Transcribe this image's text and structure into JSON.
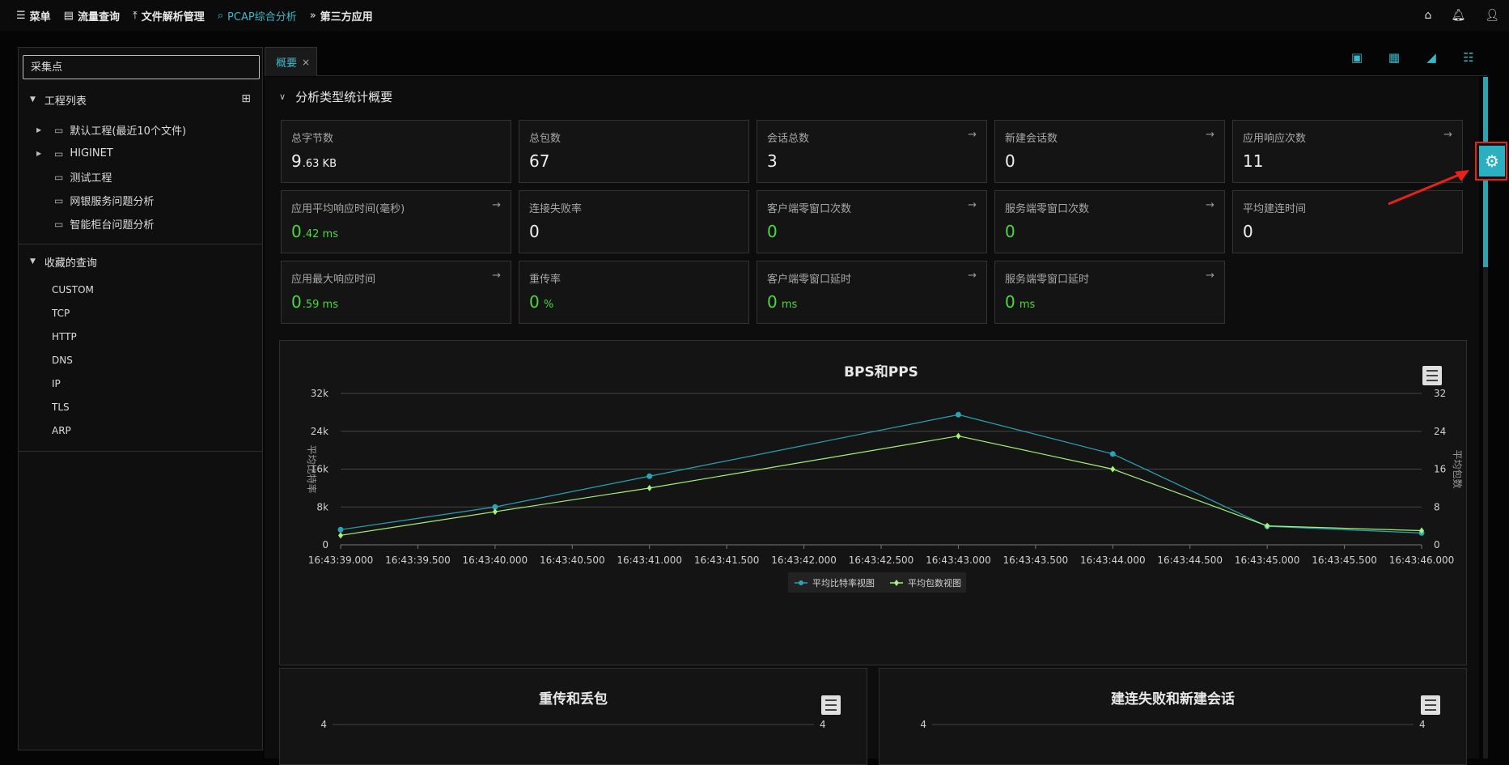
{
  "topnav": {
    "items": [
      {
        "label": "菜单",
        "icon": "hamburger-icon",
        "glyph": "☰"
      },
      {
        "label": "流量查询",
        "icon": "document-icon",
        "glyph": "▤"
      },
      {
        "label": "文件解析管理",
        "icon": "upload-icon",
        "glyph": "⤒"
      },
      {
        "label": "PCAP综合分析",
        "icon": "search-icon",
        "glyph": "⌕"
      },
      {
        "label": "第三方应用",
        "icon": "double-chevron-icon",
        "glyph": "»"
      }
    ]
  },
  "sidebar": {
    "search_placeholder": "采集点",
    "project_title": "工程列表",
    "projects": [
      "默认工程(最近10个文件)",
      "HIGINET",
      "测试工程",
      "网银服务问题分析",
      "智能柜台问题分析"
    ],
    "favorites_title": "收藏的查询",
    "queries": [
      "CUSTOM",
      "TCP",
      "HTTP",
      "DNS",
      "IP",
      "TLS",
      "ARP"
    ]
  },
  "tab": {
    "label": "概要"
  },
  "section": {
    "title": "分析类型统计概要"
  },
  "cards": [
    {
      "label": "总字节数",
      "value": "9",
      "unit": ".63 KB",
      "arrow": false,
      "green": false
    },
    {
      "label": "总包数",
      "value": "67",
      "unit": "",
      "arrow": false,
      "green": false
    },
    {
      "label": "会话总数",
      "value": "3",
      "unit": "",
      "arrow": true,
      "green": false
    },
    {
      "label": "新建会话数",
      "value": "0",
      "unit": "",
      "arrow": true,
      "green": false
    },
    {
      "label": "应用响应次数",
      "value": "11",
      "unit": "",
      "arrow": true,
      "green": false
    },
    {
      "label": "应用平均响应时间(毫秒)",
      "value": "0",
      "unit": ".42 ms",
      "arrow": true,
      "green": true
    },
    {
      "label": "连接失败率",
      "value": "0",
      "unit": "",
      "arrow": false,
      "green": false
    },
    {
      "label": "客户端零窗口次数",
      "value": "0",
      "unit": "",
      "arrow": true,
      "green": true
    },
    {
      "label": "服务端零窗口次数",
      "value": "0",
      "unit": "",
      "arrow": true,
      "green": true
    },
    {
      "label": "平均建连时间",
      "value": "0",
      "unit": "",
      "arrow": false,
      "green": false
    },
    {
      "label": "应用最大响应时间",
      "value": "0",
      "unit": ".59 ms",
      "arrow": true,
      "green": true
    },
    {
      "label": "重传率",
      "value": "0",
      "unit": " %",
      "arrow": false,
      "green": true
    },
    {
      "label": "客户端零窗口延时",
      "value": "0",
      "unit": " ms",
      "arrow": true,
      "green": true
    },
    {
      "label": "服务端零窗口延时",
      "value": "0",
      "unit": " ms",
      "arrow": true,
      "green": true
    }
  ],
  "colors": {
    "accent": "#3ab8c8",
    "green": "#4ad93a",
    "bps": "#2aa3b3",
    "pps": "#a6f27a",
    "highlight": "#e8211a"
  },
  "chart_data": [
    {
      "type": "line",
      "title": "BPS和PPS",
      "ylabel_left": "平均比特率",
      "ylabel_right": "平均包数",
      "x": [
        "16:43:39.000",
        "16:43:39.500",
        "16:43:40.000",
        "16:43:40.500",
        "16:43:41.000",
        "16:43:41.500",
        "16:43:42.000",
        "16:43:42.500",
        "16:43:43.000",
        "16:43:43.500",
        "16:43:44.000",
        "16:43:44.500",
        "16:43:45.000",
        "16:43:45.500",
        "16:43:46.000"
      ],
      "y_left_ticks": [
        "0",
        "8k",
        "16k",
        "24k",
        "32k"
      ],
      "y_right_ticks": [
        "0",
        "8",
        "16",
        "24",
        "32"
      ],
      "ylim": [
        0,
        32000
      ],
      "grid": true,
      "legend": "bottom",
      "series": [
        {
          "name": "平均比特率视图",
          "axis": "left",
          "x": [
            0,
            2,
            4,
            8,
            10,
            12,
            14
          ],
          "values": [
            3200,
            8000,
            14500,
            27500,
            19200,
            3900,
            2500
          ]
        },
        {
          "name": "平均包数视图",
          "axis": "right",
          "x": [
            0,
            2,
            4,
            8,
            10,
            12,
            14
          ],
          "values": [
            2,
            7,
            12,
            23,
            16,
            4,
            3
          ]
        }
      ]
    },
    {
      "type": "line",
      "title": "重传和丢包",
      "y_left_ticks": [
        "4"
      ],
      "y_right_ticks": [
        "4"
      ]
    },
    {
      "type": "line",
      "title": "建连失败和新建会话",
      "y_left_ticks": [
        "4"
      ],
      "y_right_ticks": [
        "4"
      ]
    }
  ]
}
